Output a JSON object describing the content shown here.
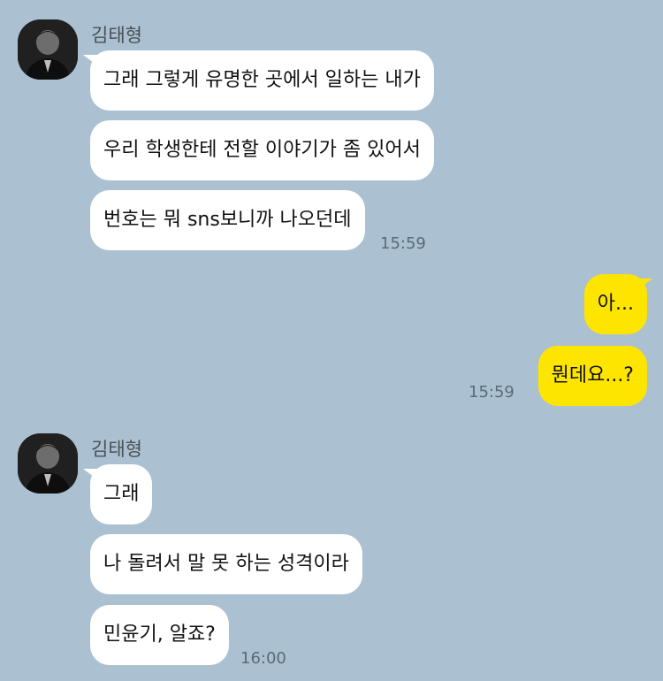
{
  "groups": [
    {
      "sender": "김태형",
      "avatar_icon": "profile-photo-icon",
      "messages": [
        "그래 그렇게 유명한 곳에서 일하는 내가",
        "우리 학생한테 전할 이야기가 좀 있어서",
        "번호는 뭐 sns보니까 나오던데"
      ],
      "time": "15:59"
    },
    {
      "sender": "me",
      "messages": [
        "아...",
        "뭔데요...?"
      ],
      "time": "15:59"
    },
    {
      "sender": "김태형",
      "avatar_icon": "profile-photo-icon",
      "messages": [
        "그래",
        "나 돌려서 말 못 하는 성격이라",
        "민윤기, 알죠?"
      ],
      "time": "16:00"
    }
  ],
  "colors": {
    "background": "#abc1d1",
    "incoming_bubble": "#ffffff",
    "outgoing_bubble": "#fee500",
    "timestamp": "#5a6a77"
  }
}
